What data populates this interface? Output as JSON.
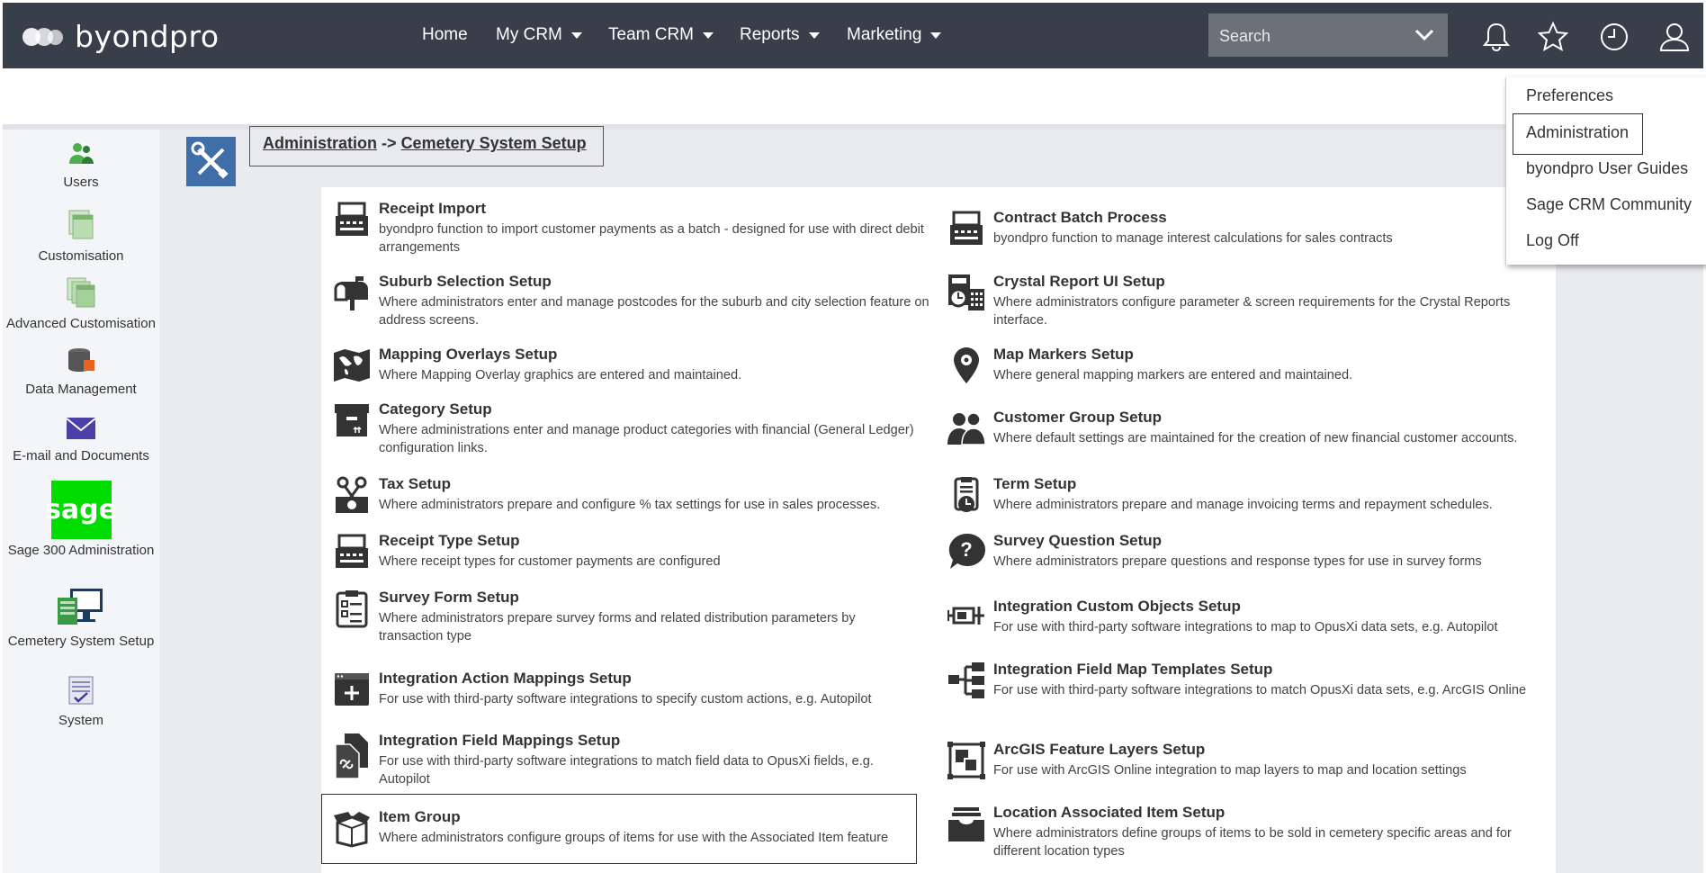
{
  "brand": {
    "name": "byondpro"
  },
  "nav": {
    "home": "Home",
    "my_crm": "My CRM",
    "team_crm": "Team CRM",
    "reports": "Reports",
    "marketing": "Marketing"
  },
  "search": {
    "placeholder": "Search"
  },
  "icons": {
    "notifications": "bell-icon",
    "favorites": "star-icon",
    "recent": "clock-icon",
    "user": "user-icon"
  },
  "user_menu": [
    "Preferences",
    "Administration",
    "byondpro User Guides",
    "Sage CRM Community",
    "Log Off"
  ],
  "sidebar": [
    {
      "label": "Users",
      "icon": "users-icon"
    },
    {
      "label": "Customisation",
      "icon": "customisation-icon"
    },
    {
      "label": "Advanced Customisation",
      "icon": "advanced-customisation-icon"
    },
    {
      "label": "Data Management",
      "icon": "data-management-icon"
    },
    {
      "label": "E-mail and Documents",
      "icon": "email-icon"
    },
    {
      "label": "Sage 300 Administration",
      "logo_text": "sage",
      "icon": "sage-logo"
    },
    {
      "label": "Cemetery System Setup",
      "icon": "cemetery-setup-icon"
    },
    {
      "label": "System",
      "icon": "system-icon"
    }
  ],
  "breadcrumb": {
    "root": "Administration",
    "separator": "->",
    "current": "Cemetery System Setup"
  },
  "left_entries": [
    {
      "title": "Receipt Import",
      "desc": "byondpro function to import customer payments as a batch - designed for use with direct debit arrangements",
      "icon": "cash-register-icon"
    },
    {
      "title": "Suburb Selection Setup",
      "desc": "Where administrators enter and manage postcodes for the suburb and city selection feature on address screens.",
      "icon": "mailbox-icon"
    },
    {
      "title": "Mapping Overlays Setup",
      "desc": "Where Mapping Overlay graphics are entered and maintained.",
      "icon": "world-map-icon"
    },
    {
      "title": "Category Setup",
      "desc": "Where administrations enter and manage product categories with financial (General Ledger) configuration links.",
      "icon": "box-icon"
    },
    {
      "title": "Tax Setup",
      "desc": "Where administrators prepare and configure % tax settings for use in sales processes.",
      "icon": "tax-icon"
    },
    {
      "title": "Receipt Type Setup",
      "desc": "Where receipt types for customer payments are configured",
      "icon": "cash-register-icon"
    },
    {
      "title": "Survey Form Setup",
      "desc": "Where administrators prepare survey forms and related distribution parameters by transaction type",
      "icon": "clipboard-icon"
    },
    {
      "title": "Integration Action Mappings Setup",
      "desc": "For use with third-party software integrations to specify custom actions, e.g. Autopilot",
      "icon": "window-plus-icon"
    },
    {
      "title": "Integration Field Mappings Setup",
      "desc": "For use with third-party software integrations to match field data to OpusXi fields, e.g. Autopilot",
      "icon": "linked-docs-icon"
    },
    {
      "title": "Item Group",
      "desc": "Where administrators configure groups of items for use with the Associated Item feature",
      "icon": "open-box-icon"
    }
  ],
  "right_entries": [
    {
      "title": "Contract Batch Process",
      "desc": "byondpro function to manage interest calculations for sales contracts",
      "icon": "cash-register-icon"
    },
    {
      "title": "Crystal Report UI Setup",
      "desc": "Where administrators configure parameter & screen requirements for the Crystal Reports interface.",
      "icon": "calculator-icon"
    },
    {
      "title": "Map Markers Setup",
      "desc": "Where general mapping markers are entered and maintained.",
      "icon": "map-marker-icon"
    },
    {
      "title": "Customer Group Setup",
      "desc": "Where default settings are maintained for the creation of new financial customer accounts.",
      "icon": "people-icon"
    },
    {
      "title": "Term Setup",
      "desc": "Where administrators prepare and manage invoicing terms and repayment schedules.",
      "icon": "term-clock-icon"
    },
    {
      "title": "Survey Question Setup",
      "desc": "Where administrators prepare questions and response types for use in survey forms",
      "icon": "question-bubble-icon"
    },
    {
      "title": "Integration Custom Objects Setup",
      "desc": "For use with third-party software integrations to map to OpusXi data sets, e.g. Autopilot",
      "icon": "custom-objects-icon"
    },
    {
      "title": "Integration Field Map Templates Setup",
      "desc": "For use with third-party software integrations to match OpusXi data sets, e.g. ArcGIS Online",
      "icon": "hierarchy-icon"
    },
    {
      "title": "ArcGIS Feature Layers Setup",
      "desc": "For use with ArcGIS Online integration to map layers to map and location settings",
      "icon": "layers-icon"
    },
    {
      "title": "Location Associated Item Setup",
      "desc": "Where administrators define groups of items to be sold in cemetery specific areas and for different location types",
      "icon": "tray-icon"
    }
  ],
  "colors": {
    "topbar": "#383e4a",
    "search_bg": "#6b7079",
    "admin_tile": "#3f6ea8",
    "sage_green": "#00dc00",
    "icon_dark": "#333333"
  }
}
